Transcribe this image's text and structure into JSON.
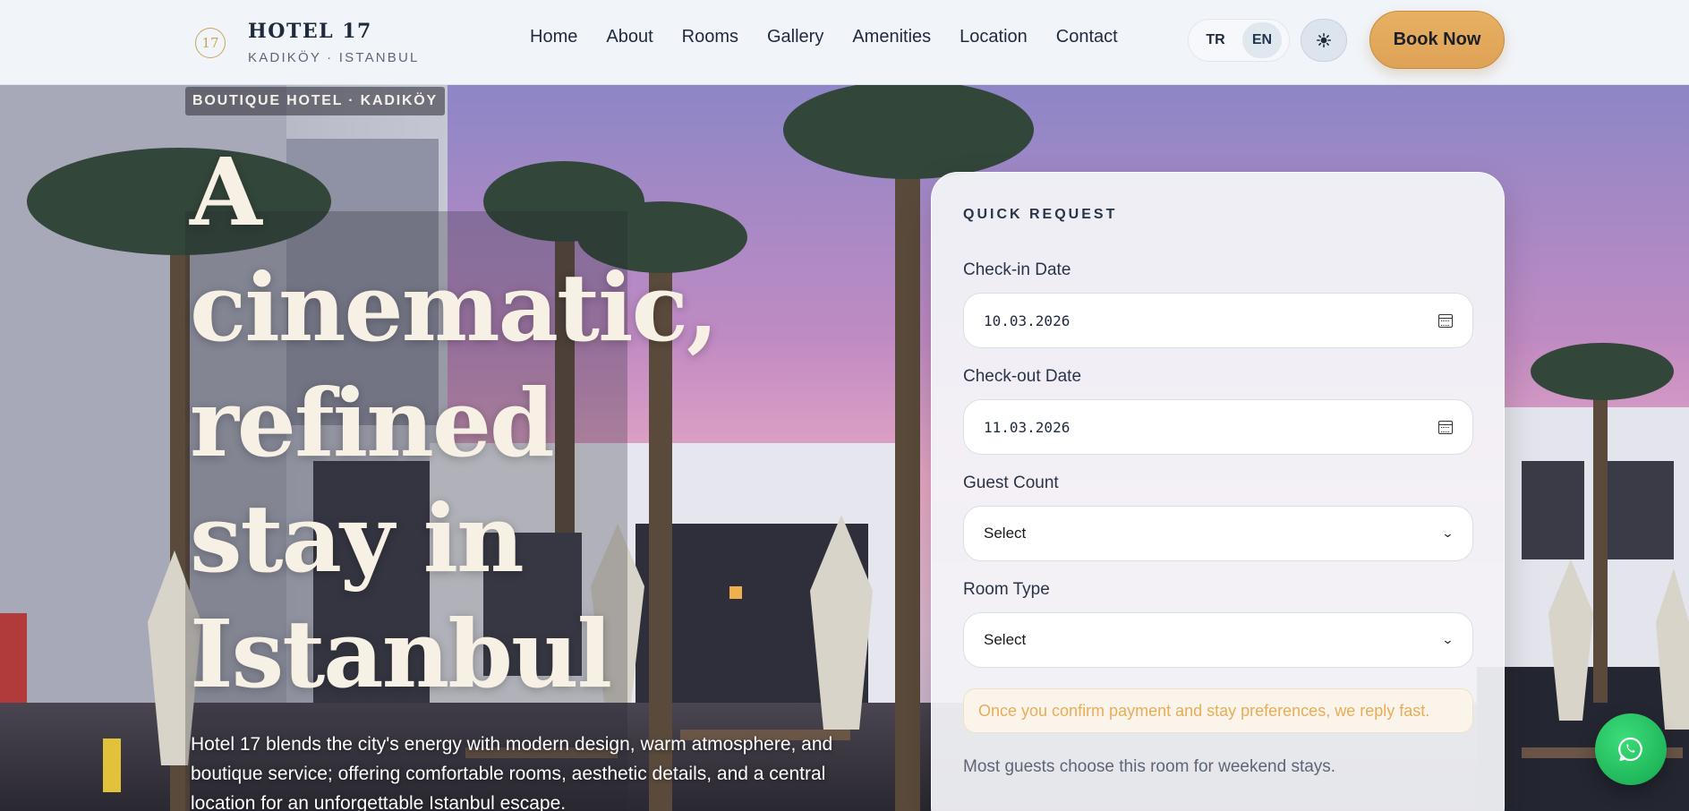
{
  "brand": {
    "mark": "17",
    "name": "HOTEL 17",
    "subtitle": "KADIKÖY · ISTANBUL"
  },
  "nav": {
    "items": [
      "Home",
      "About",
      "Rooms",
      "Gallery",
      "Amenities",
      "Location",
      "Contact"
    ]
  },
  "language": {
    "options": [
      "TR",
      "EN"
    ],
    "active": "EN"
  },
  "theme_toggle": {
    "icon": "sun-icon"
  },
  "book_button": {
    "label": "Book Now"
  },
  "hero": {
    "badge": "BOUTIQUE HOTEL · KADIKÖY",
    "headline": [
      "A",
      "cinematic,",
      "refined",
      "stay in",
      "Istanbul"
    ],
    "intro": "Hotel 17 blends the city's energy with modern design, warm atmosphere, and boutique service; offering comfortable rooms, aesthetic details, and a central location for an unforgettable Istanbul escape."
  },
  "quick_request": {
    "title": "QUICK REQUEST",
    "checkin": {
      "label": "Check-in Date",
      "value": "10.03.2026"
    },
    "checkout": {
      "label": "Check-out Date",
      "value": "11.03.2026"
    },
    "guests": {
      "label": "Guest Count",
      "value": "Select"
    },
    "room": {
      "label": "Room Type",
      "value": "Select"
    },
    "note": "Once you confirm payment and stay preferences, we reply fast.",
    "hint": "Most guests choose this room for weekend stays."
  },
  "colors": {
    "accent": "#e0a65a",
    "header_bg": "#f1f4f9",
    "whatsapp": "#1fbf5e"
  },
  "chat_button": {
    "icon": "whatsapp-icon"
  }
}
